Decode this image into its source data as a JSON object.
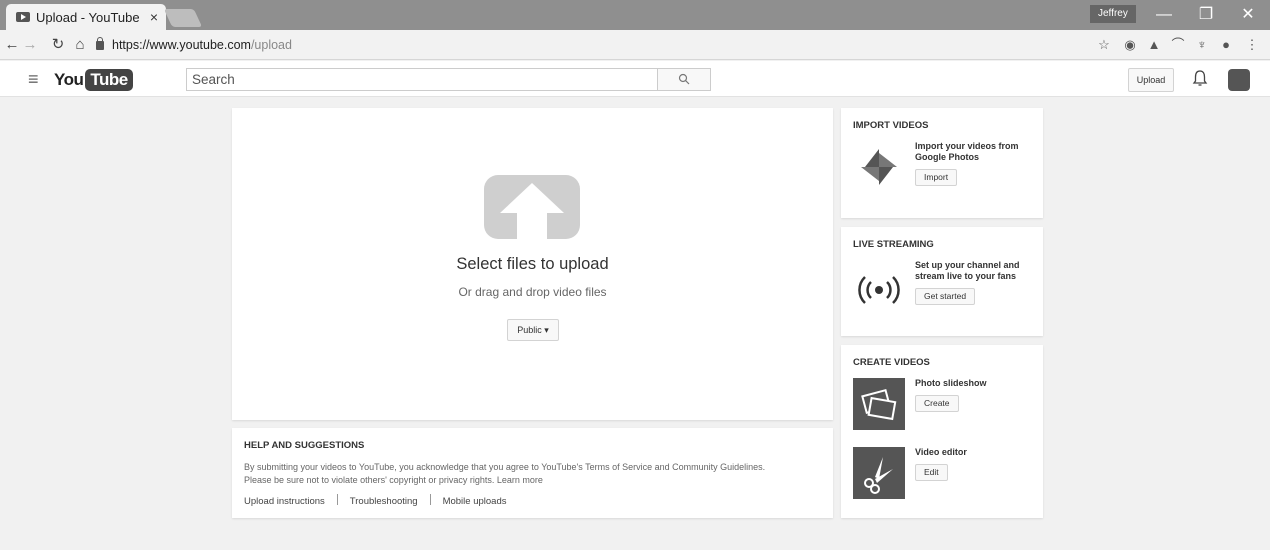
{
  "browser": {
    "tab_title": "Upload - YouTube",
    "tab_close": "×",
    "profile_name": "Jeffrey",
    "url_host": "https://www.youtube.com",
    "url_path": "/upload",
    "window_controls": [
      "—",
      "❐",
      "✕"
    ]
  },
  "header": {
    "logo_you": "You",
    "logo_tube": "Tube",
    "search_placeholder": "Search",
    "upload_label": "Upload"
  },
  "upload": {
    "title": "Select files to upload",
    "subtitle": "Or drag and drop video files",
    "privacy_value": "Public ▾"
  },
  "help": {
    "title": "HELP AND SUGGESTIONS",
    "text_line1": "By submitting your videos to YouTube, you acknowledge that you agree to YouTube's Terms of Service and Community Guidelines.",
    "text_line2": "Please be sure not to violate others' copyright or privacy rights. Learn more",
    "links": [
      "Upload instructions",
      "Troubleshooting",
      "Mobile uploads"
    ]
  },
  "import_videos": {
    "title": "IMPORT VIDEOS",
    "description": "Import your videos from Google Photos",
    "button": "Import"
  },
  "live_streaming": {
    "title": "LIVE STREAMING",
    "description": "Set up your channel and stream live to your fans",
    "button": "Get started"
  },
  "create_videos": {
    "title": "CREATE VIDEOS",
    "items": [
      {
        "label": "Photo slideshow",
        "button": "Create"
      },
      {
        "label": "Video editor",
        "button": "Edit"
      }
    ]
  },
  "icons": {
    "tab": "youtube-icon",
    "import": "google-photos-icon",
    "live": "broadcast-icon",
    "slideshow": "photo-slideshow-icon",
    "editor": "video-editor-icon"
  }
}
